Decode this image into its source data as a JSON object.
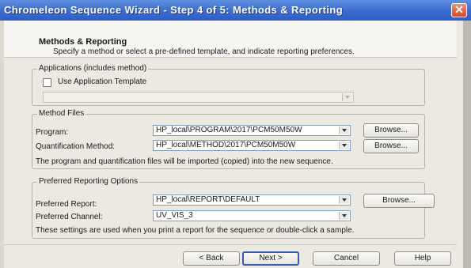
{
  "window": {
    "title": "Chromeleon Sequence Wizard - Step 4 of 5: Methods & Reporting",
    "close_glyph": "✕"
  },
  "header": {
    "title": "Methods & Reporting",
    "subtitle": "Specify a method or select a pre-defined template, and indicate reporting preferences."
  },
  "applications": {
    "legend": "Applications (includes method)",
    "checkbox_label": "Use Application Template",
    "checked": false,
    "template_value": ""
  },
  "method_files": {
    "legend": "Method Files",
    "program_label": "Program:",
    "program_value": "HP_local\\PROGRAM\\2017\\PCM50M50W",
    "quant_label": "Quantification Method:",
    "quant_value": "HP_local\\METHOD\\2017\\PCM50M50W",
    "browse": "Browse...",
    "note": "The program and quantification files will be imported (copied) into the new sequence."
  },
  "reporting": {
    "legend": "Preferred Reporting Options",
    "report_label": "Preferred Report:",
    "report_value": "HP_local\\REPORT\\DEFAULT",
    "channel_label": "Preferred Channel:",
    "channel_value": "UV_VIS_3",
    "browse": "Browse...",
    "note": "These settings are used when you print a report for the sequence or double-click a sample."
  },
  "footer": {
    "back": "< Back",
    "next": "Next >",
    "cancel": "Cancel",
    "help": "Help"
  },
  "colors": {
    "titlebar": "#3a6bd0",
    "dialog_bg": "#ebe9e2",
    "close": "#d8482a"
  }
}
